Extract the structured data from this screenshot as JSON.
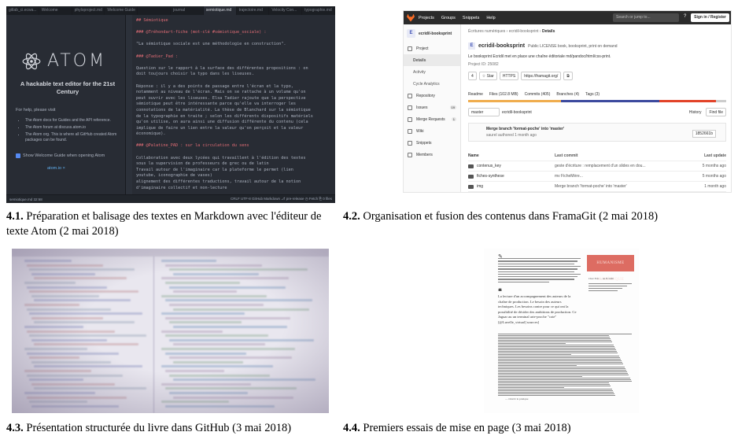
{
  "captions": [
    {
      "num": "4.1.",
      "text": "Préparation et balisage des textes en Markdown avec l'éditeur de texte Atom (2 mai 2018)"
    },
    {
      "num": "4.2.",
      "text": "Organisation et fusion des contenus dans FramaGit (2 mai 2018)"
    },
    {
      "num": "4.3.",
      "text": "Présentation structurée du livre dans GitHub (3 mai 2018)"
    },
    {
      "num": "4.4.",
      "text": "Premiers essais de mise en page (3 mai 2018)"
    }
  ],
  "atom": {
    "tabs": [
      "gitlab_ci.ecwa...",
      "Welcome",
      "phyloproject.md",
      "Welcome Guide",
      "",
      "journal",
      "semiotique.md",
      "trajectoire.md",
      "Velocity Con...",
      "typographie.md"
    ],
    "wordmark": "ATOM",
    "tagline": "A hackable text editor for the 21st Century",
    "help_title": "For help, please visit",
    "help_items": [
      "The Atom docs for Guides and the API reference.",
      "The Atom forum at discuss.atom.io",
      "The Atom org. This is where all GitHub created Atom packages can be found."
    ],
    "checkbox_label": "Show Welcome Guide when opening Atom",
    "footer_link": "atom.io ×",
    "code_lines": [
      {
        "text": "## Sémiotique",
        "heading": true
      },
      {
        "text": "",
        "heading": false
      },
      {
        "text": "### @Tréhondart-fiche (mot-clé #sémiotique_sociale) :",
        "heading": true
      },
      {
        "text": "",
        "heading": false
      },
      {
        "text": "\"La sémiotique sociale est une méthodologie en construction\".",
        "heading": false
      },
      {
        "text": "",
        "heading": false
      },
      {
        "text": "### @Tadier_Pad :",
        "heading": true
      },
      {
        "text": "",
        "heading": false
      },
      {
        "text": "Question sur le rapport à la surface des différentes propositions : on",
        "heading": false
      },
      {
        "text": "doit toujours choisir la typo dans les liseuses.",
        "heading": false
      },
      {
        "text": "",
        "heading": false
      },
      {
        "text": "Réponse : il y a des points de passage entre l'écran et la typo,",
        "heading": false
      },
      {
        "text": "notamment au niveau de l'écran. Mais on se rattache à un volume qu'on",
        "heading": false
      },
      {
        "text": "peut ouvrir avec les liseuses. Elsa Tadier rajoute que la perspective",
        "heading": false
      },
      {
        "text": "sémiotique peut être intéressante parce qu'elle va interroger les",
        "heading": false
      },
      {
        "text": "connotations de la matérialité. La thèse de Blanchard sur la sémiotique",
        "heading": false
      },
      {
        "text": "de la typographie en traite ; selon les différents dispositifs matériels",
        "heading": false
      },
      {
        "text": "qu'on utilise, on aura ainsi une diffusion différente du contenu (cela",
        "heading": false
      },
      {
        "text": "implique de faire un lien entre la valeur qu'on perçoit et la valeur",
        "heading": false
      },
      {
        "text": "économique).",
        "heading": false
      },
      {
        "text": "",
        "heading": false
      },
      {
        "text": "### @Palatine_PAD : sur la circulation du sens",
        "heading": true
      },
      {
        "text": "",
        "heading": false
      },
      {
        "text": "Collaboration avec deux lycées qui travaillent à l'édition des textes",
        "heading": false
      },
      {
        "text": "sous la supervision de professeurs de grec ou de latin",
        "heading": false
      },
      {
        "text": "Travail autour de l'imaginaire car la plateforme le permet (lien",
        "heading": false
      },
      {
        "text": "youtube, iconographie de vases)",
        "heading": false
      },
      {
        "text": "alignement des différentes traductions, travail autour de la notion",
        "heading": false
      },
      {
        "text": "d'imaginaire collectif et non-lecture",
        "heading": false
      }
    ],
    "status_left": "semiotique.md  32:68",
    "status_right": "CRLF  UTF-8  GitHub Markdown  ⎇ pre-release  ◷ Fetch  ⎘ 0 files"
  },
  "gitlab": {
    "nav": [
      "Projects",
      "Groups",
      "Snippets",
      "Help"
    ],
    "search_placeholder": "Search or jump to...",
    "signin": "Sign in / Register",
    "project_name": "ecridil-booksprint",
    "project_letter": "E",
    "sidebar": [
      {
        "label": "Project",
        "sub": false,
        "active": false,
        "count": ""
      },
      {
        "label": "Details",
        "sub": true,
        "active": true,
        "count": ""
      },
      {
        "label": "Activity",
        "sub": true,
        "active": false,
        "count": ""
      },
      {
        "label": "Cycle Analytics",
        "sub": true,
        "active": false,
        "count": ""
      },
      {
        "label": "Repository",
        "sub": false,
        "active": false,
        "count": ""
      },
      {
        "label": "Issues",
        "sub": false,
        "active": false,
        "count": "19"
      },
      {
        "label": "Merge Requests",
        "sub": false,
        "active": false,
        "count": "1"
      },
      {
        "label": "Wiki",
        "sub": false,
        "active": false,
        "count": ""
      },
      {
        "label": "Snippets",
        "sub": false,
        "active": false,
        "count": ""
      },
      {
        "label": "Members",
        "sub": false,
        "active": false,
        "count": ""
      }
    ],
    "breadcrumb_parent": "Écritures numériques",
    "breadcrumb_project": "ecridil-booksprint",
    "breadcrumb_current": "Details",
    "title": "ecridil-booksprint",
    "title_meta": "Public  LICENSE  book, booksprint, print on demand",
    "description": "Le booksprint Ecridil met en place une chaîne éditoriale md/pandoc/html/css-print.",
    "project_id": "Project ID: 25082",
    "star_count": "4",
    "star_label": "Star",
    "protocol": "HTTPS",
    "clone_url": "https://framagit.org/",
    "stats": [
      "Readme",
      "Files (102.8 MB)",
      "Commits (405)",
      "Branches (4)",
      "Tags (3)"
    ],
    "branch": "master",
    "path": "ecridil-booksprint",
    "history_label": "History",
    "find_label": "Find file",
    "commit_message": "Merge branch 'format-poche' into 'master'",
    "commit_author": "saurel authored 1 month ago",
    "commit_sha": "1852661b",
    "table_headers": [
      "Name",
      "Last commit",
      "Last update"
    ],
    "rows": [
      {
        "name": "contenus_key",
        "commit": "geste d'écriture : remplacement d'un slides en dou...",
        "update": "5 months ago"
      },
      {
        "name": "fiches-synthese",
        "commit": "mv FicheMère...",
        "update": "5 months ago"
      },
      {
        "name": "img",
        "commit": "Merge branch 'format-poche' into 'master'",
        "update": "1 month ago"
      }
    ],
    "colors": {
      "orange": "#f0ad4e",
      "blue": "#3c4a9e",
      "red": "#e24329",
      "gray": "#cccccc"
    }
  },
  "layout_page": {
    "banner": "HUMANISME NUMÉRIQUE",
    "side_note": "Cher Eric ... au Ecridil",
    "quote": "La lecture d'un accompagnement des auteurs de la chaîne de production. Le besoin des auteurs techniques. Les besoins contre pour ce qui ont la possibilité de décider des ambitions de production. Ce Jaguar au un terminal arte-proche \"cote\" [@Luvelle_virtual] sources]",
    "footer": "— Ouvrir la pratique"
  }
}
